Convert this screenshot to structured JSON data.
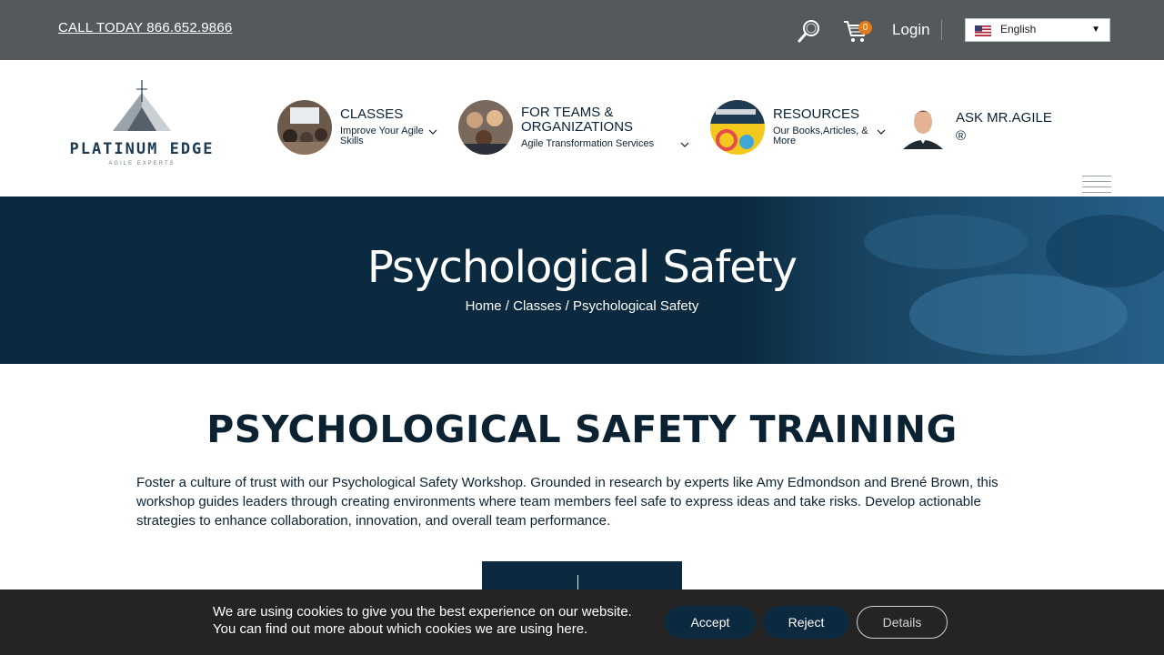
{
  "topbar": {
    "phone": "CALL TODAY 866.652.9866",
    "cart_count": "0",
    "login": "Login",
    "language": "English"
  },
  "logo": {
    "name": "PLATINUM EDGE",
    "tagline": "AGILE EXPERTS"
  },
  "nav": {
    "items": [
      {
        "title": "CLASSES",
        "subtitle": "Improve Your Agile Skills"
      },
      {
        "title": "FOR TEAMS & ORGANIZATIONS",
        "subtitle": "Agile Transformation Services"
      },
      {
        "title": "RESOURCES",
        "subtitle": "Our Books,Articles, & More"
      },
      {
        "title": "ASK MR.AGILE ®",
        "subtitle": ""
      }
    ]
  },
  "hero": {
    "title": "Psychological Safety",
    "breadcrumb": [
      "Home",
      "Classes",
      "Psychological Safety"
    ],
    "separator": " / "
  },
  "main": {
    "heading": "PSYCHOLOGICAL SAFETY TRAINING",
    "intro": "Foster a culture of trust with our Psychological Safety Workshop. Grounded in research by experts like Amy Edmondson and Brené Brown, this workshop guides leaders through creating environments where team members feel safe to express ideas and take risks. Develop actionable strategies to enhance collaboration, innovation, and overall team performance."
  },
  "cookie": {
    "line1": "We are using cookies to give you the best experience on our website.",
    "line2": "You can find out more about which cookies we are using here.",
    "accept": "Accept",
    "reject": "Reject",
    "details": "Details"
  },
  "colors": {
    "topbar_bg": "#54595c",
    "navy": "#0b2a3f",
    "cart_badge": "#e07b1e",
    "cookie_bg": "#242424"
  }
}
